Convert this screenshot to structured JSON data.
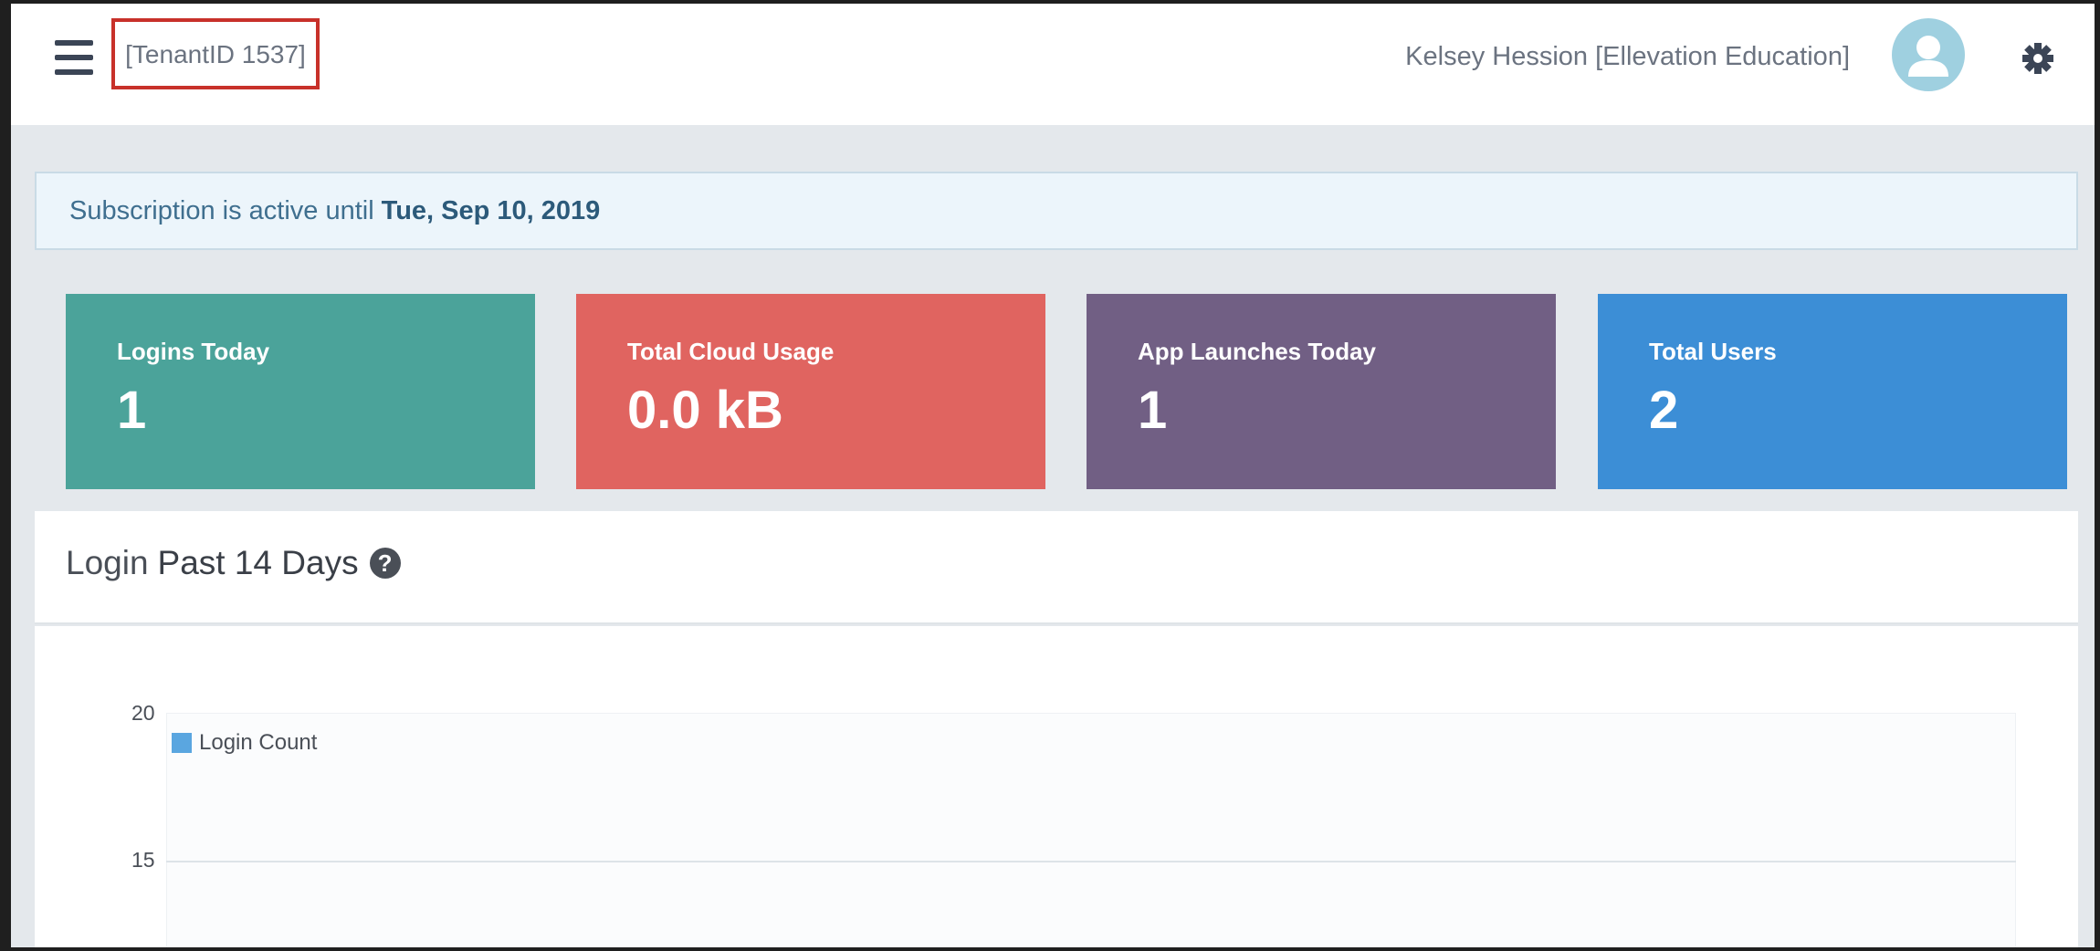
{
  "header": {
    "tenant_label": "[TenantID 1537]",
    "user_label": "Kelsey Hession [Ellevation Education]",
    "icons": {
      "menu": "hamburger-menu-icon",
      "avatar": "user-avatar-icon",
      "settings": "gear-icon"
    }
  },
  "subscription": {
    "prefix": "Subscription is active until",
    "date": "Tue, Sep 10, 2019"
  },
  "stats": [
    {
      "label": "Logins Today",
      "value": "1",
      "color": "#4ba39a"
    },
    {
      "label": "Total Cloud Usage",
      "value": "0.0 kB",
      "color": "#e06460"
    },
    {
      "label": "App Launches Today",
      "value": "1",
      "color": "#715f84"
    },
    {
      "label": "Total Users",
      "value": "2",
      "color": "#3c8ed6"
    }
  ],
  "login_panel": {
    "title_light": "Login",
    "title_strong": "Past 14 Days",
    "help_icon": "question-circle-icon"
  },
  "chart_data": {
    "type": "bar",
    "title": "",
    "series": [
      {
        "name": "Login Count",
        "color": "#5aa6e0",
        "values": []
      }
    ],
    "categories": [],
    "y_ticks_visible": [
      "20",
      "15"
    ],
    "ylim": [
      0,
      20
    ],
    "legend": "top-left",
    "grid": true
  }
}
